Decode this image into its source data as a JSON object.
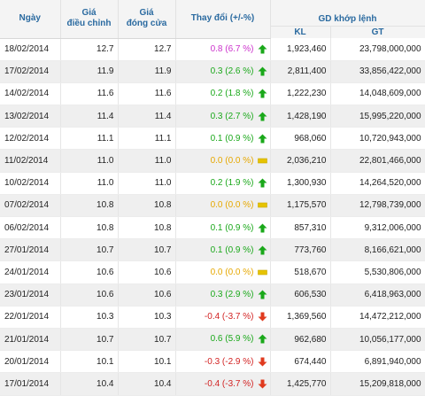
{
  "header": {
    "date": "Ngày",
    "adjusted_price": "Giá\nđiều chỉnh",
    "closing_price": "Giá\nđóng cửa",
    "change": "Thay đổi (+/-%)",
    "matched_group": "GD khớp lệnh",
    "kl": "KL",
    "gt": "GT"
  },
  "colors": {
    "up": "#1aa81a",
    "unchanged": "#e6a800",
    "down": "#d22222",
    "first_row_change": "#cc33cc",
    "header_text": "#2a6aa0"
  },
  "rows": [
    {
      "date": "18/02/2014",
      "adjusted": "12.7",
      "close": "12.7",
      "change": "0.8 (6.7 %)",
      "trend": "up",
      "tone": "pink",
      "kl": "1,923,460",
      "gt": "23,798,000,000"
    },
    {
      "date": "17/02/2014",
      "adjusted": "11.9",
      "close": "11.9",
      "change": "0.3 (2.6 %)",
      "trend": "up",
      "tone": "up",
      "kl": "2,811,400",
      "gt": "33,856,422,000"
    },
    {
      "date": "14/02/2014",
      "adjusted": "11.6",
      "close": "11.6",
      "change": "0.2 (1.8 %)",
      "trend": "up",
      "tone": "up",
      "kl": "1,222,230",
      "gt": "14,048,609,000"
    },
    {
      "date": "13/02/2014",
      "adjusted": "11.4",
      "close": "11.4",
      "change": "0.3 (2.7 %)",
      "trend": "up",
      "tone": "up",
      "kl": "1,428,190",
      "gt": "15,995,220,000"
    },
    {
      "date": "12/02/2014",
      "adjusted": "11.1",
      "close": "11.1",
      "change": "0.1 (0.9 %)",
      "trend": "up",
      "tone": "up",
      "kl": "968,060",
      "gt": "10,720,943,000"
    },
    {
      "date": "11/02/2014",
      "adjusted": "11.0",
      "close": "11.0",
      "change": "0.0 (0.0 %)",
      "trend": "same",
      "tone": "same",
      "kl": "2,036,210",
      "gt": "22,801,466,000"
    },
    {
      "date": "10/02/2014",
      "adjusted": "11.0",
      "close": "11.0",
      "change": "0.2 (1.9 %)",
      "trend": "up",
      "tone": "up",
      "kl": "1,300,930",
      "gt": "14,264,520,000"
    },
    {
      "date": "07/02/2014",
      "adjusted": "10.8",
      "close": "10.8",
      "change": "0.0 (0.0 %)",
      "trend": "same",
      "tone": "same",
      "kl": "1,175,570",
      "gt": "12,798,739,000"
    },
    {
      "date": "06/02/2014",
      "adjusted": "10.8",
      "close": "10.8",
      "change": "0.1 (0.9 %)",
      "trend": "up",
      "tone": "up",
      "kl": "857,310",
      "gt": "9,312,006,000"
    },
    {
      "date": "27/01/2014",
      "adjusted": "10.7",
      "close": "10.7",
      "change": "0.1 (0.9 %)",
      "trend": "up",
      "tone": "up",
      "kl": "773,760",
      "gt": "8,166,621,000"
    },
    {
      "date": "24/01/2014",
      "adjusted": "10.6",
      "close": "10.6",
      "change": "0.0 (0.0 %)",
      "trend": "same",
      "tone": "same",
      "kl": "518,670",
      "gt": "5,530,806,000"
    },
    {
      "date": "23/01/2014",
      "adjusted": "10.6",
      "close": "10.6",
      "change": "0.3 (2.9 %)",
      "trend": "up",
      "tone": "up",
      "kl": "606,530",
      "gt": "6,418,963,000"
    },
    {
      "date": "22/01/2014",
      "adjusted": "10.3",
      "close": "10.3",
      "change": "-0.4 (-3.7 %)",
      "trend": "down",
      "tone": "down",
      "kl": "1,369,560",
      "gt": "14,472,212,000"
    },
    {
      "date": "21/01/2014",
      "adjusted": "10.7",
      "close": "10.7",
      "change": "0.6 (5.9 %)",
      "trend": "up",
      "tone": "up",
      "kl": "962,680",
      "gt": "10,056,177,000"
    },
    {
      "date": "20/01/2014",
      "adjusted": "10.1",
      "close": "10.1",
      "change": "-0.3 (-2.9 %)",
      "trend": "down",
      "tone": "down",
      "kl": "674,440",
      "gt": "6,891,940,000"
    },
    {
      "date": "17/01/2014",
      "adjusted": "10.4",
      "close": "10.4",
      "change": "-0.4 (-3.7 %)",
      "trend": "down",
      "tone": "down",
      "kl": "1,425,770",
      "gt": "15,209,818,000"
    }
  ]
}
